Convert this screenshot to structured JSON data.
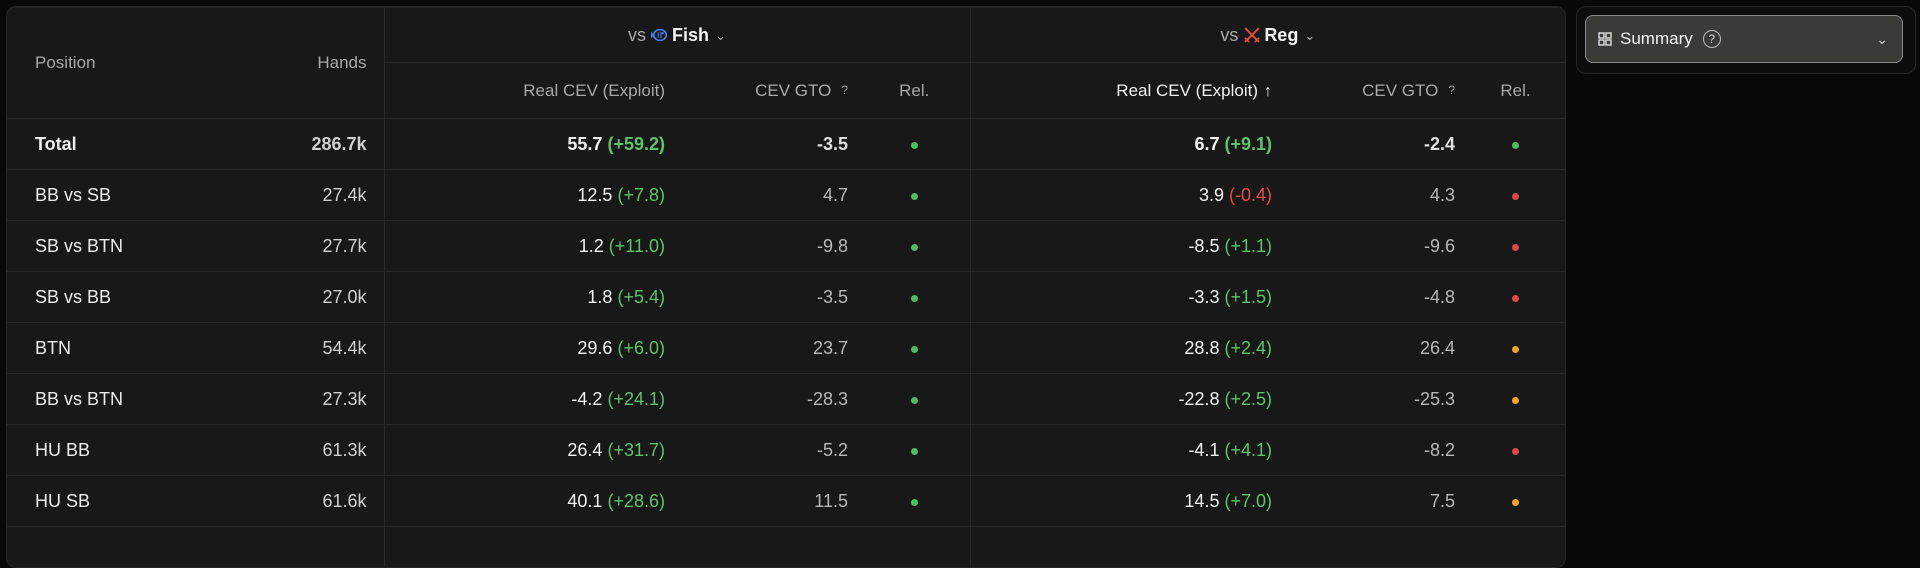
{
  "columns": {
    "position": "Position",
    "hands": "Hands",
    "real_cev": "Real CEV (Exploit)",
    "cev_gto": "CEV GTO",
    "rel": "Rel.",
    "help_mark": "?"
  },
  "groups": {
    "fish": {
      "prefix": "vs",
      "name": "Fish",
      "icon": "fish-icon"
    },
    "reg": {
      "prefix": "vs",
      "name": "Reg",
      "icon": "crossed-swords-icon",
      "sort_indicator": "↑"
    }
  },
  "colors": {
    "positive": "#5ec36a",
    "negative": "#e64a4a",
    "dot_green": "#4ebd5e",
    "dot_red": "#e24747",
    "dot_orange": "#eea62a"
  },
  "rows": [
    {
      "position": "Total",
      "hands": "286.7k",
      "fish": {
        "real": "55.7",
        "delta": "(+59.2)",
        "gto": "-3.5",
        "rel": "green"
      },
      "reg": {
        "real": "6.7",
        "delta": "(+9.1)",
        "gto": "-2.4",
        "rel": "green"
      }
    },
    {
      "position": "BB vs SB",
      "hands": "27.4k",
      "fish": {
        "real": "12.5",
        "delta": "(+7.8)",
        "gto": "4.7",
        "rel": "green"
      },
      "reg": {
        "real": "3.9",
        "delta": "(-0.4)",
        "gto": "4.3",
        "rel": "red"
      }
    },
    {
      "position": "SB vs BTN",
      "hands": "27.7k",
      "fish": {
        "real": "1.2",
        "delta": "(+11.0)",
        "gto": "-9.8",
        "rel": "green"
      },
      "reg": {
        "real": "-8.5",
        "delta": "(+1.1)",
        "gto": "-9.6",
        "rel": "red"
      }
    },
    {
      "position": "SB vs BB",
      "hands": "27.0k",
      "fish": {
        "real": "1.8",
        "delta": "(+5.4)",
        "gto": "-3.5",
        "rel": "green"
      },
      "reg": {
        "real": "-3.3",
        "delta": "(+1.5)",
        "gto": "-4.8",
        "rel": "red"
      }
    },
    {
      "position": "BTN",
      "hands": "54.4k",
      "fish": {
        "real": "29.6",
        "delta": "(+6.0)",
        "gto": "23.7",
        "rel": "green"
      },
      "reg": {
        "real": "28.8",
        "delta": "(+2.4)",
        "gto": "26.4",
        "rel": "orange"
      }
    },
    {
      "position": "BB vs BTN",
      "hands": "27.3k",
      "fish": {
        "real": "-4.2",
        "delta": "(+24.1)",
        "gto": "-28.3",
        "rel": "green"
      },
      "reg": {
        "real": "-22.8",
        "delta": "(+2.5)",
        "gto": "-25.3",
        "rel": "orange"
      }
    },
    {
      "position": "HU BB",
      "hands": "61.3k",
      "fish": {
        "real": "26.4",
        "delta": "(+31.7)",
        "gto": "-5.2",
        "rel": "green"
      },
      "reg": {
        "real": "-4.1",
        "delta": "(+4.1)",
        "gto": "-8.2",
        "rel": "red"
      }
    },
    {
      "position": "HU SB",
      "hands": "61.6k",
      "fish": {
        "real": "40.1",
        "delta": "(+28.6)",
        "gto": "11.5",
        "rel": "green"
      },
      "reg": {
        "real": "14.5",
        "delta": "(+7.0)",
        "gto": "7.5",
        "rel": "orange"
      }
    }
  ],
  "summary": {
    "label": "Summary",
    "help": "?",
    "icon": "grid-icon",
    "chevron": "chevron-down-icon"
  }
}
